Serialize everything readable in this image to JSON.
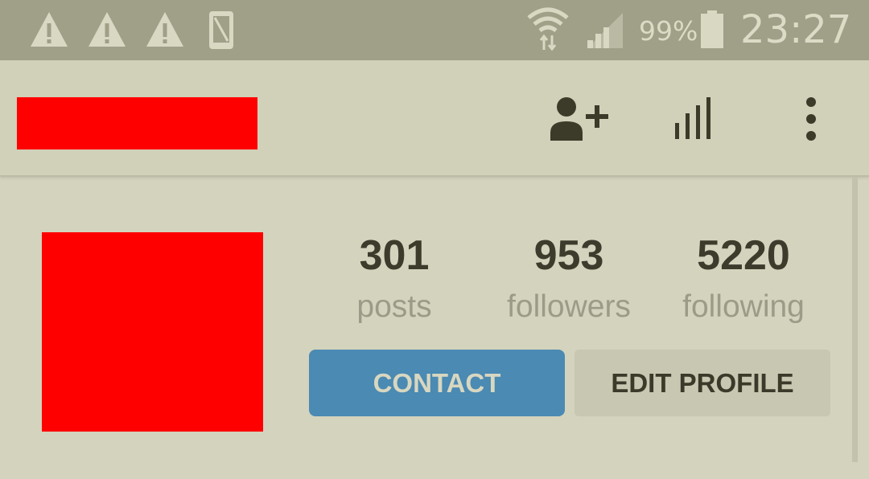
{
  "status_bar": {
    "notifications": [
      "warning-icon",
      "warning-icon",
      "warning-icon",
      "phone-icon"
    ],
    "battery_pct": "99%",
    "clock": "23:27"
  },
  "app_bar": {
    "actions": [
      "add-person-icon",
      "bar-chart-icon",
      "more-vert-icon"
    ]
  },
  "profile": {
    "stats": [
      {
        "value": "301",
        "label": "posts"
      },
      {
        "value": "953",
        "label": "followers"
      },
      {
        "value": "5220",
        "label": "following"
      }
    ],
    "contact_label": "CONTACT",
    "edit_label": "EDIT PROFILE"
  },
  "colors": {
    "background": "#d4d3bd",
    "status_bar": "#a09f87",
    "accent_blue": "#4a8ab3",
    "redacted": "#ff0000"
  }
}
